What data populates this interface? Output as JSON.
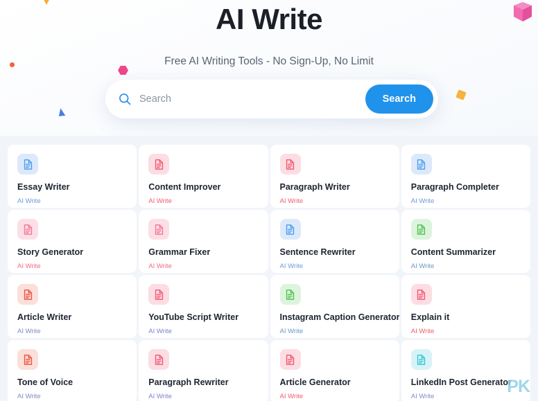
{
  "header": {
    "title": "AI Write",
    "subtitle": "Free AI Writing Tools - No Sign-Up, No Limit"
  },
  "search": {
    "icon": "search-icon",
    "placeholder": "Search",
    "value": "",
    "button_label": "Search",
    "button_color": "#1f92ec"
  },
  "decorations": [
    {
      "name": "triangle-orange",
      "color": "#f9a826"
    },
    {
      "name": "dot-red",
      "color": "#f4603e"
    },
    {
      "name": "hexagon-pink",
      "color": "#f0468a"
    },
    {
      "name": "triangle-blue",
      "color": "#4a7fe0"
    },
    {
      "name": "square-orange",
      "color": "#f6b33d"
    },
    {
      "name": "cube-pink",
      "color": "#f472b6"
    }
  ],
  "palette": {
    "blue": {
      "fg": "#4a9bf0",
      "bg": "#dce9fb",
      "sub": "#6d9ad8"
    },
    "red": {
      "fg": "#f3546e",
      "bg": "#fcdde3",
      "sub": "#ef5c6e"
    },
    "pink": {
      "fg": "#f4738e",
      "bg": "#fcdfe6",
      "sub": "#ef6a80"
    },
    "orange": {
      "fg": "#f04e3e",
      "bg": "#fbdfd9",
      "sub": "#7d88c4"
    },
    "green": {
      "fg": "#4fc04f",
      "bg": "#ddf4dc",
      "sub": "#6c96c9"
    },
    "cyan": {
      "fg": "#2ec4d8",
      "bg": "#d7f3f7",
      "sub": "#7f8cc9"
    },
    "violet": {
      "fg": "#f3546e",
      "bg": "#fcdde3",
      "sub": "#7b82cf"
    }
  },
  "grid": {
    "subtitle_label": "AI Write",
    "icon_name": "document-icon",
    "cards": [
      {
        "title": "Essay Writer",
        "subtitle": "AI Write",
        "theme": "blue"
      },
      {
        "title": "Content Improver",
        "subtitle": "AI Write",
        "theme": "red"
      },
      {
        "title": "Paragraph Writer",
        "subtitle": "AI Write",
        "theme": "red"
      },
      {
        "title": "Paragraph Completer",
        "subtitle": "AI Write",
        "theme": "blue"
      },
      {
        "title": "Story Generator",
        "subtitle": "AI Write",
        "theme": "pink"
      },
      {
        "title": "Grammar Fixer",
        "subtitle": "AI Write",
        "theme": "pink"
      },
      {
        "title": "Sentence Rewriter",
        "subtitle": "AI Write",
        "theme": "blue"
      },
      {
        "title": "Content Summarizer",
        "subtitle": "AI Write",
        "theme": "green"
      },
      {
        "title": "Article Writer",
        "subtitle": "AI Write",
        "theme": "orange"
      },
      {
        "title": "YouTube Script Writer",
        "subtitle": "AI Write",
        "theme": "violet"
      },
      {
        "title": "Instagram Caption Generator",
        "subtitle": "AI Write",
        "theme": "green"
      },
      {
        "title": "Explain it",
        "subtitle": "AI Write",
        "theme": "red"
      },
      {
        "title": "Tone of Voice",
        "subtitle": "AI Write",
        "theme": "orange"
      },
      {
        "title": "Paragraph Rewriter",
        "subtitle": "AI Write",
        "theme": "violet"
      },
      {
        "title": "Article Generator",
        "subtitle": "AI Write",
        "theme": "red"
      },
      {
        "title": "LinkedIn Post Generator",
        "subtitle": "AI Write",
        "theme": "cyan"
      }
    ]
  },
  "watermark": {
    "text": "PK"
  }
}
